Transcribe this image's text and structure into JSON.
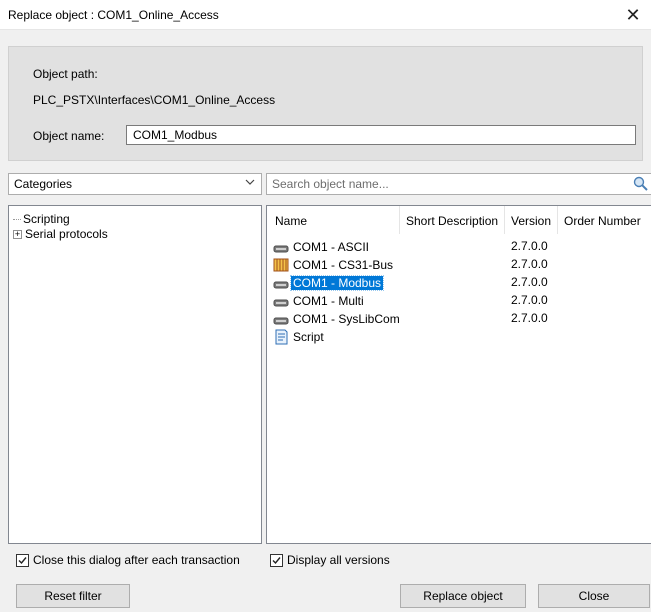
{
  "window": {
    "title": "Replace object : COM1_Online_Access",
    "close_glyph": "✕"
  },
  "info": {
    "path_label": "Object path:",
    "path_value": "PLC_PSTX\\Interfaces\\COM1_Online_Access",
    "name_label": "Object name:",
    "name_value": "COM1_Modbus"
  },
  "filter": {
    "categories_value": "Categories",
    "search_placeholder": "Search object name..."
  },
  "tree": {
    "items": [
      {
        "label": "Scripting",
        "expander": ""
      },
      {
        "label": "Serial protocols",
        "expander": "+"
      }
    ]
  },
  "list": {
    "columns": [
      "Name",
      "Short Description",
      "Version",
      "Order Number"
    ],
    "rows": [
      {
        "name": "COM1 - ASCII",
        "version": "2.7.0.0",
        "icon": "serial-port-icon",
        "selected": false
      },
      {
        "name": "COM1 - CS31-Bus",
        "version": "2.7.0.0",
        "icon": "bus-module-icon",
        "selected": false
      },
      {
        "name": "COM1 - Modbus",
        "version": "2.7.0.0",
        "icon": "serial-port-icon",
        "selected": true
      },
      {
        "name": "COM1 - Multi",
        "version": "2.7.0.0",
        "icon": "serial-port-icon",
        "selected": false
      },
      {
        "name": "COM1 - SysLibCom",
        "version": "2.7.0.0",
        "icon": "serial-port-icon",
        "selected": false
      },
      {
        "name": "Script",
        "version": "",
        "icon": "script-icon",
        "selected": false
      }
    ]
  },
  "options": {
    "close_after_label": "Close this dialog after each transaction",
    "close_after_checked": true,
    "display_all_label": "Display all versions",
    "display_all_checked": true
  },
  "buttons": {
    "reset_filter": "Reset filter",
    "replace_object": "Replace object",
    "close": "Close"
  },
  "colors": {
    "selection": "#0078d7",
    "panel": "#e1e1e1",
    "background": "#f0f0f0"
  }
}
